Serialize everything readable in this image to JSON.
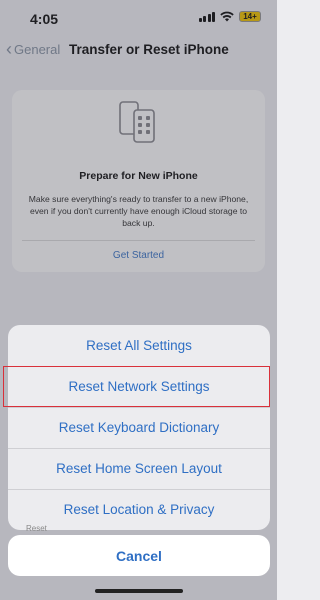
{
  "status": {
    "time": "4:05",
    "battery": "14+"
  },
  "nav": {
    "back_label": "General",
    "title": "Transfer or Reset iPhone"
  },
  "card": {
    "title": "Prepare for New iPhone",
    "text": "Make sure everything's ready to transfer to a new iPhone, even if you don't currently have enough iCloud storage to back up.",
    "link": "Get Started"
  },
  "sheet": {
    "actions": [
      {
        "label": "Reset All Settings"
      },
      {
        "label": "Reset Network Settings"
      },
      {
        "label": "Reset Keyboard Dictionary"
      },
      {
        "label": "Reset Home Screen Layout"
      },
      {
        "label": "Reset Location & Privacy"
      }
    ],
    "cancel_label": "Cancel",
    "behind_text": "Reset"
  },
  "colors": {
    "accent": "#2f6fc4",
    "highlight": "#d9303a"
  }
}
